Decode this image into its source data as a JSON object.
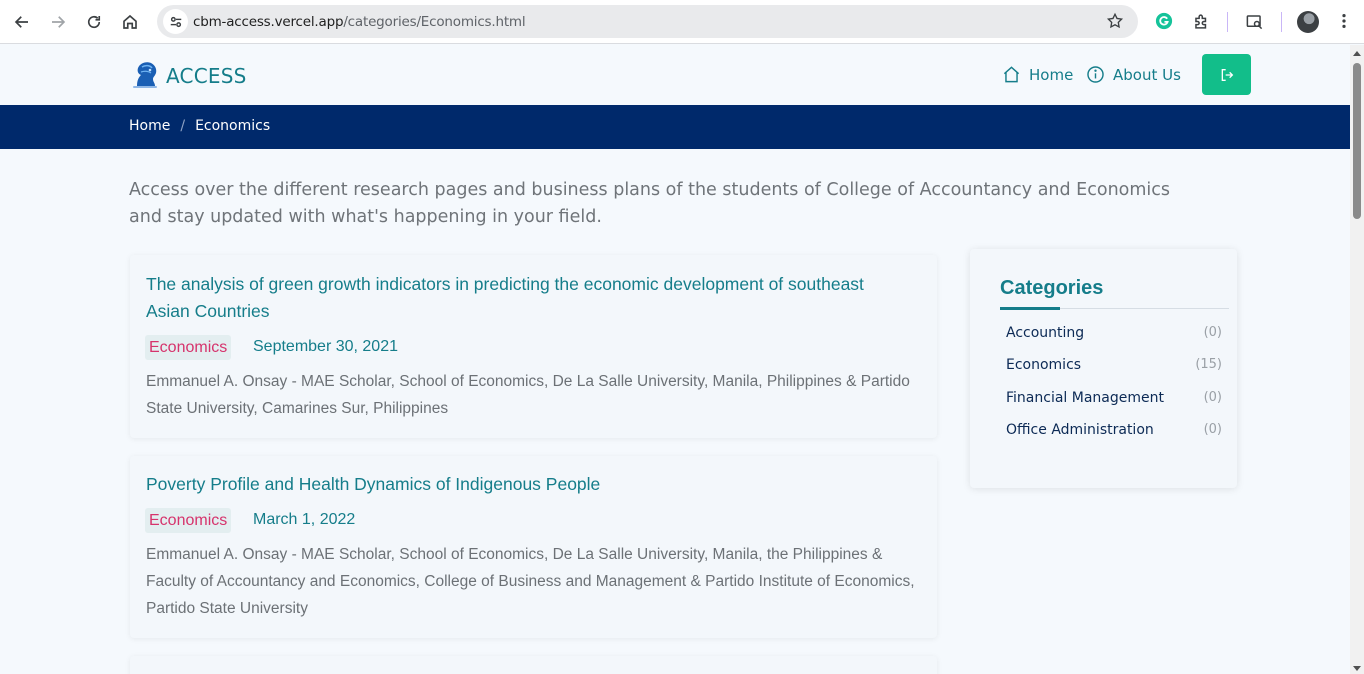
{
  "browser": {
    "url_host": "cbm-access.vercel.app",
    "url_path": "/categories/Economics.html"
  },
  "site": {
    "logo_text": "ACCESS",
    "nav": [
      {
        "label": "Home",
        "icon": "house-icon"
      },
      {
        "label": "About Us",
        "icon": "info-circle-icon"
      }
    ],
    "logout_icon": "sign-out-icon",
    "accent_color": "#157d8a",
    "button_color": "#12be8a",
    "crumb_bar_color": "#00296b"
  },
  "breadcrumb": {
    "home": "Home",
    "separator": "/",
    "current": "Economics"
  },
  "intro": "Access over the different research pages and business plans of the students of College of Accountancy and Economics and stay updated with what's happening in your field.",
  "posts": [
    {
      "title": "The analysis of green growth indicators in predicting the economic development of southeast Asian Countries",
      "category": "Economics",
      "date": "September 30, 2021",
      "authors": "Emmanuel A. Onsay - MAE Scholar, School of Economics, De La Salle University, Manila, Philippines & Partido State University, Camarines Sur, Philippines"
    },
    {
      "title": "Poverty Profile and Health Dynamics of Indigenous People",
      "category": "Economics",
      "date": "March 1, 2022",
      "authors": "Emmanuel A. Onsay - MAE Scholar, School of Economics, De La Salle University, Manila, the Philippines & Faculty of Accountancy and Economics, College of Business and Management & Partido Institute of Economics, Partido State University"
    }
  ],
  "sidebar": {
    "title": "Categories",
    "categories": [
      {
        "name": "Accounting",
        "count": "(0)"
      },
      {
        "name": "Economics",
        "count": "(15)"
      },
      {
        "name": "Financial Management",
        "count": "(0)"
      },
      {
        "name": "Office Administration",
        "count": "(0)"
      }
    ]
  }
}
